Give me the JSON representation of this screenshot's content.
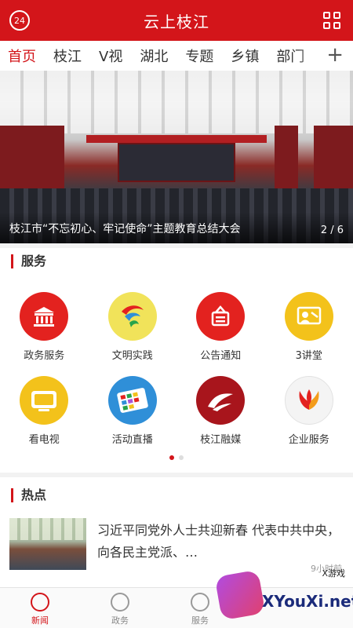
{
  "header": {
    "title": "云上枝江",
    "badge": "24"
  },
  "tabs": [
    "首页",
    "枝江",
    "V视",
    "湖北",
    "专题",
    "乡镇",
    "部门"
  ],
  "banner": {
    "caption": "枝江市“不忘初心、牢记使命”主题教育总结大会",
    "pager": "2 / 6"
  },
  "services": {
    "title": "服务",
    "items": [
      {
        "label": "政务服务",
        "icon": "government-building-icon",
        "color": "#e3221f"
      },
      {
        "label": "文明实践",
        "icon": "civilization-practice-icon",
        "color": "#f1e35a"
      },
      {
        "label": "公告通知",
        "icon": "announcement-icon",
        "color": "#e3221f"
      },
      {
        "label": "3讲堂",
        "icon": "lecture-icon",
        "color": "#f3c21b"
      },
      {
        "label": "看电视",
        "icon": "tv-icon",
        "color": "#f3c21b"
      },
      {
        "label": "活动直播",
        "icon": "live-broadcast-icon",
        "color": "#2f8fd8"
      },
      {
        "label": "枝江融媒",
        "icon": "zhijiang-media-icon",
        "color": "#a8151c"
      },
      {
        "label": "企业服务",
        "icon": "enterprise-service-icon",
        "color": "#f4f4f4"
      }
    ]
  },
  "hot": {
    "title": "热点",
    "news": {
      "title": "习近平同党外人士共迎新春 代表中共中央，向各民主党派、…",
      "time": "9小时前"
    }
  },
  "nav": [
    {
      "label": "新闻",
      "icon": "news-icon"
    },
    {
      "label": "政务",
      "icon": "government-icon"
    },
    {
      "label": "服务",
      "icon": "service-icon"
    },
    {
      "label": "",
      "icon": ""
    }
  ],
  "watermark": {
    "small": "X游戏",
    "text": "XYouXi.net"
  }
}
